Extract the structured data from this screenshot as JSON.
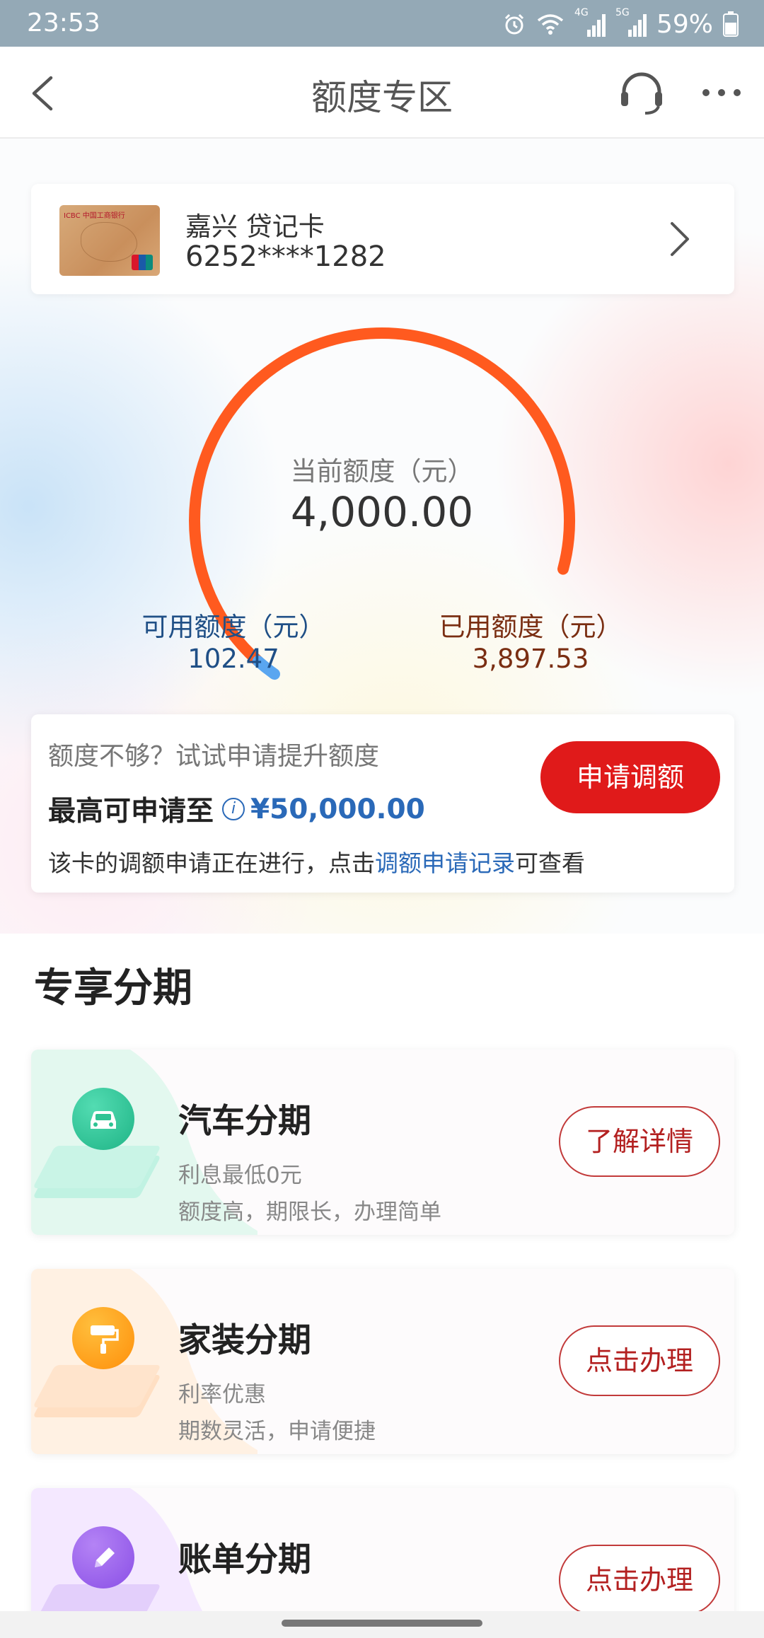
{
  "status_bar": {
    "time": "23:53",
    "battery": "59%",
    "net1": "4G",
    "net2": "5G"
  },
  "nav": {
    "title": "额度专区"
  },
  "card": {
    "name": "嘉兴 贷记卡",
    "number": "6252****1282",
    "logo_text": "ICBC 中国工商银行"
  },
  "gauge": {
    "current_label": "当前额度（元）",
    "current_value": "4,000.00",
    "available_label": "可用额度（元）",
    "available_value": "102.47",
    "used_label": "已用额度（元）",
    "used_value": "3,897.53",
    "available_fraction": 0.0256,
    "colors": {
      "used": "#ff5a1f",
      "available": "#5aa6f0"
    }
  },
  "raise": {
    "question": "额度不够？试试申请提升额度",
    "max_label": "最高可申请至",
    "info_icon": "i",
    "max_amount": "¥50,000.00",
    "note_prefix": "该卡的调额申请正在进行，点击",
    "note_link": "调额申请记录",
    "note_suffix": "可查看",
    "button": "申请调额"
  },
  "section": {
    "title": "专享分期"
  },
  "installments": [
    {
      "title": "汽车分期",
      "line1": "利息最低0元",
      "line2": "额度高，期限长，办理简单",
      "button": "了解详情",
      "icon": "car-icon"
    },
    {
      "title": "家装分期",
      "line1": "利率优惠",
      "line2": "期数灵活，申请便捷",
      "button": "点击办理",
      "icon": "paint-roller-icon"
    },
    {
      "title": "账单分期",
      "line1": "",
      "line2": "",
      "button": "点击办理",
      "icon": "pencil-icon"
    }
  ]
}
